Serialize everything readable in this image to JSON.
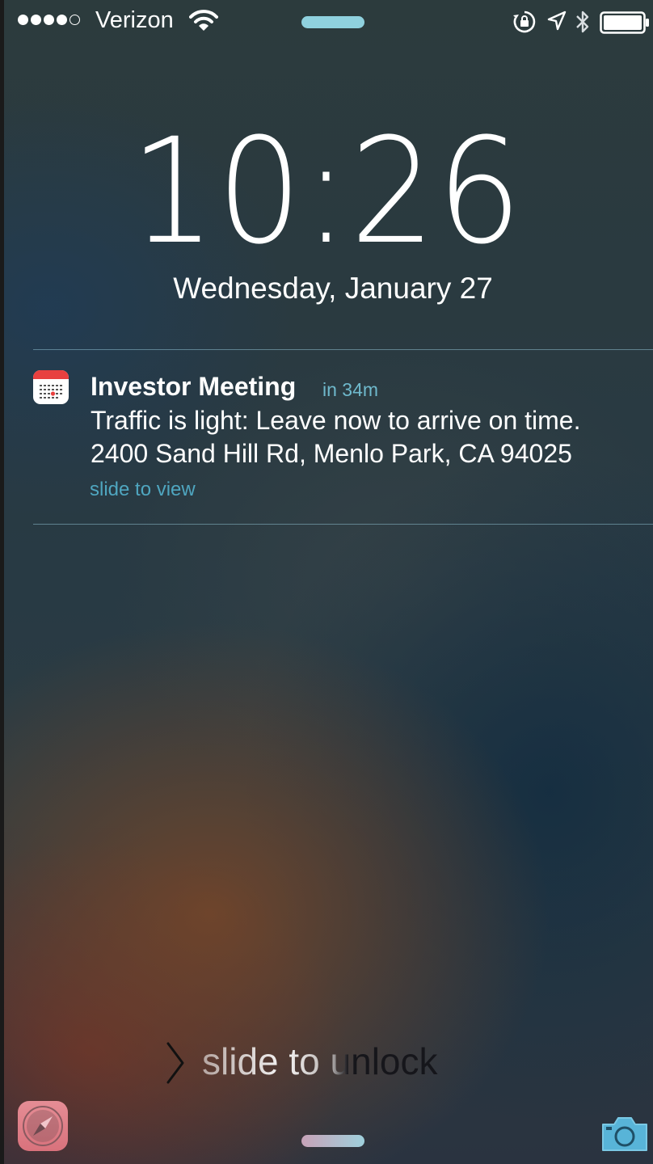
{
  "status_bar": {
    "signal_filled": 4,
    "signal_total": 5,
    "carrier": "Verizon",
    "icons": [
      "wifi-icon",
      "rotation-lock-icon",
      "location-arrow-icon",
      "bluetooth-icon",
      "battery-icon"
    ],
    "battery_level": 1.0
  },
  "lock_screen": {
    "time": "10:26",
    "date": "Wednesday, January 27"
  },
  "notification": {
    "app_icon": "calendar-icon",
    "title": "Investor Meeting",
    "time_label": "in 34m",
    "body_line1": "Traffic is light: Leave now to arrive on time.",
    "body_line2": "2400 Sand Hill Rd, Menlo Park, CA 94025",
    "action": "slide to view"
  },
  "unlock": {
    "label": "slide to unlock",
    "icon": "chevron-right-icon"
  },
  "bottom": {
    "left_icon": "safari-icon",
    "right_icon": "camera-icon"
  },
  "colors": {
    "accent_teal": "#6fb9cc",
    "calendar_red": "#e8403f",
    "grabber": "#8fd1de"
  }
}
